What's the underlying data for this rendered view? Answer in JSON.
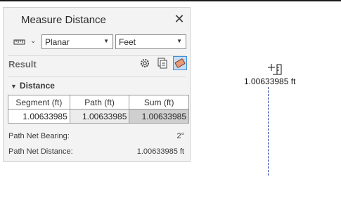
{
  "panel": {
    "title": "Measure Distance",
    "mode": "Planar",
    "unit": "Feet",
    "result_label": "Result",
    "distance_section": "Distance",
    "table": {
      "headers": [
        "Segment (ft)",
        "Path (ft)",
        "Sum (ft)"
      ],
      "row": [
        "1.00633985",
        "1.00633985",
        "1.00633985"
      ]
    },
    "net_bearing_label": "Path Net Bearing:",
    "net_bearing_value": "2°",
    "net_distance_label": "Path Net Distance:",
    "net_distance_value": "1.00633985 ft"
  },
  "map": {
    "measurement_label": "1.00633985 ft"
  },
  "colors": {
    "panel_bg": "#f3f3f3",
    "accent": "#3c8fd8",
    "measure_line": "#1f3fa8"
  },
  "icons": [
    "ruler-icon",
    "chevron-down-icon",
    "close-icon",
    "gear-icon",
    "copy-icon",
    "eraser-icon"
  ]
}
